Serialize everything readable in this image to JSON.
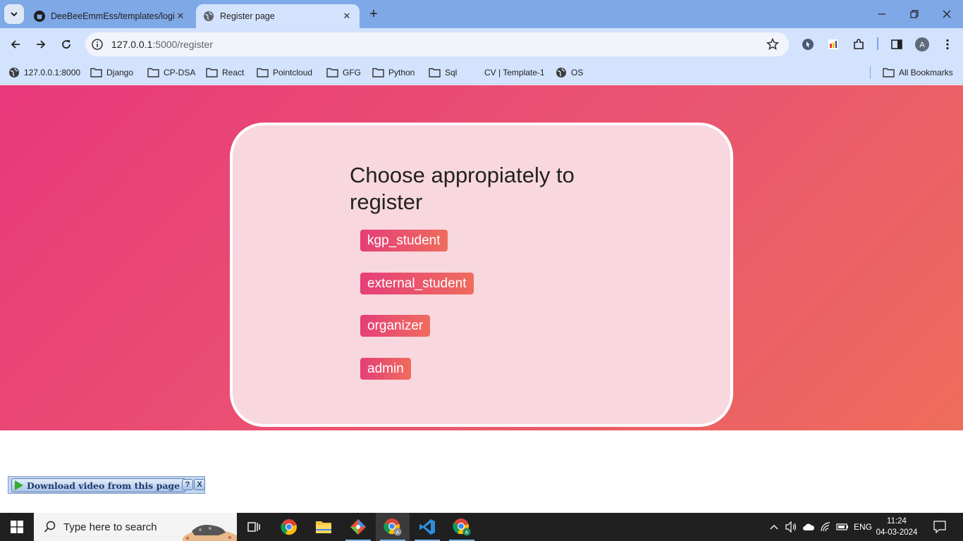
{
  "browser": {
    "tabs": [
      {
        "title": "DeeBeeEmmEss/templates/logi",
        "active": false
      },
      {
        "title": "Register page",
        "active": true
      }
    ],
    "url_host": "127.0.0.1",
    "url_path": ":5000/register",
    "bookmarks": [
      "127.0.0.1:8000",
      "Django",
      "CP-DSA",
      "React",
      "Pointcloud",
      "GFG",
      "Python",
      "Sql",
      "CV | Template-1",
      "OS"
    ],
    "all_bookmarks_label": "All Bookmarks",
    "profile_initial": "A"
  },
  "page": {
    "heading": "Choose appropiately to register",
    "roles": [
      "kgp_student",
      "external_student",
      "organizer",
      "admin"
    ],
    "colors": {
      "gradient_start": "#e8397b",
      "gradient_end": "#ee6d5b",
      "card": "#f8d7df",
      "button": "#e53e79"
    }
  },
  "download_bar": {
    "label": "Download video from this page",
    "help": "?",
    "close": "X"
  },
  "taskbar": {
    "search_placeholder": "Type here to search",
    "language": "ENG",
    "time": "11:24",
    "date": "04-03-2024",
    "apps": [
      "task-view-icon",
      "chrome-icon",
      "file-explorer-icon",
      "git-icon",
      "chrome-profile-icon",
      "vscode-icon",
      "chrome-profile-icon"
    ]
  }
}
